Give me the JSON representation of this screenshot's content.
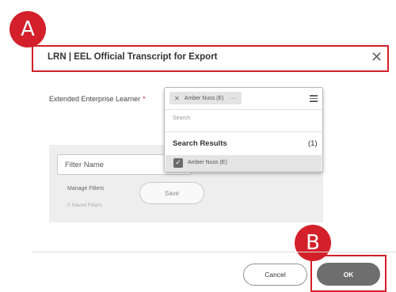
{
  "callouts": {
    "a": "A",
    "b": "B"
  },
  "dialog": {
    "title": "LRN | EEL Official Transcript for Export"
  },
  "field": {
    "label": "Extended Enterprise Learner",
    "required_marker": "*"
  },
  "prompt": {
    "selected_chip": "Amber Nuss (E)",
    "search_placeholder": "Search",
    "results_label": "Search Results",
    "results_count": "(1)",
    "results": [
      {
        "label": "Amber Nuss (E)",
        "checked": true
      }
    ]
  },
  "filters": {
    "name_placeholder": "Filter Name",
    "manage_label": "Manage Filters",
    "saved_count": "0 Saved Filters",
    "save_label": "Save"
  },
  "footer": {
    "cancel_label": "Cancel",
    "ok_label": "OK"
  },
  "colors": {
    "callout_red": "#d3202a",
    "ok_button": "#6e6e6e",
    "panel_gray": "#eeeeee"
  },
  "icons": {
    "close": "close-icon",
    "chip_remove": "chip-remove-icon",
    "chip_more": "more-options-icon",
    "prompt_list": "list-icon",
    "checkbox": "checkbox-checked-icon"
  }
}
